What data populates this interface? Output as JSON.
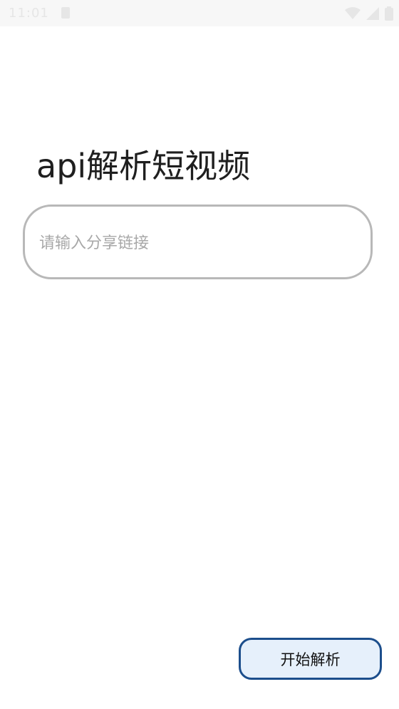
{
  "status_bar": {
    "time": "11:01",
    "sim_icon": "sim-card-icon",
    "wifi_icon": "wifi-icon",
    "signal_icon": "signal-icon",
    "battery_icon": "battery-icon",
    "icon_color": "#e6e6e6",
    "background": "#f7f7f7"
  },
  "header": {
    "title": "api解析短视频"
  },
  "link_input": {
    "value": "",
    "placeholder": "请输入分享链接"
  },
  "actions": {
    "start_label": "开始解析"
  },
  "colors": {
    "accent_border": "#1c4e8c",
    "button_fill": "#e6f0fb",
    "input_border": "#b8b8b8"
  }
}
